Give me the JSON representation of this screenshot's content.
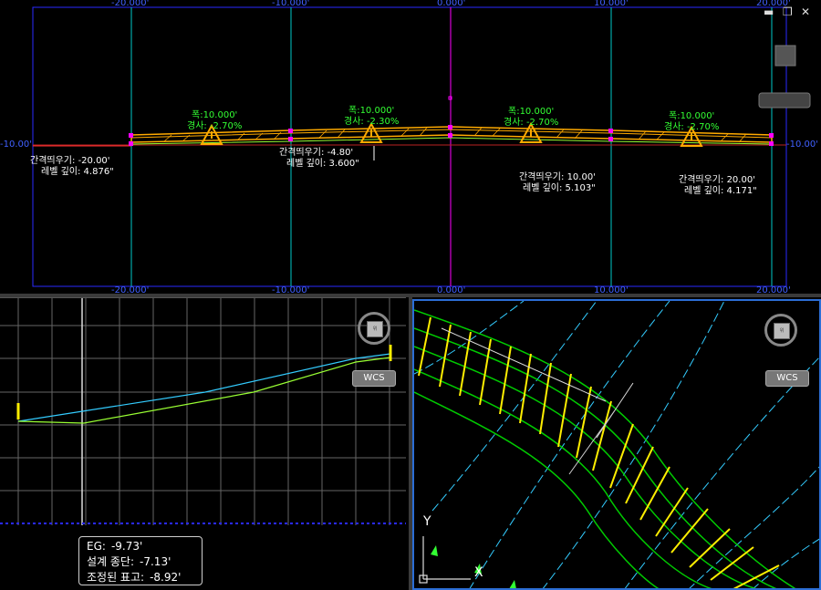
{
  "top": {
    "axis_top": [
      "-20.000'",
      "-10.000'",
      "0.000'",
      "10.000'",
      "20.000'"
    ],
    "axis_bottom": [
      "-20.000'",
      "-10.000'",
      "0.000'",
      "10.000'",
      "20.000'"
    ],
    "axis_left": "-10.00'",
    "axis_right": "-10.00'",
    "slopes": [
      {
        "width": "폭:10.000'",
        "slope": "경사: -2.70%"
      },
      {
        "width": "폭:10.000'",
        "slope": "경사: -2.30%"
      },
      {
        "width": "폭:10.000'",
        "slope": "경사: -2.70%"
      },
      {
        "width": "폭:10.000'",
        "slope": "경사: -2.70%"
      }
    ],
    "offsets": [
      {
        "offset_label": "간격띄우기:",
        "offset_value": "-20.00'",
        "depth_label": "레벨 깊이:",
        "depth_value": "4.876\""
      },
      {
        "offset_label": "간격띄우기:",
        "offset_value": "-4.80'",
        "depth_label": "레벨 깊이:",
        "depth_value": "3.600\""
      },
      {
        "offset_label": "간격띄우기:",
        "offset_value": "10.00'",
        "depth_label": "레벨 깊이:",
        "depth_value": "5.103\""
      },
      {
        "offset_label": "간격띄우기:",
        "offset_value": "20.00'",
        "depth_label": "레벨 깊이:",
        "depth_value": "4.171\""
      }
    ],
    "window_buttons": {
      "minimize": "▬",
      "restore": "❐",
      "close": "✕"
    }
  },
  "views": {
    "left_cube_face": "위",
    "left_wcs": "WCS",
    "right_cube_face": "위",
    "right_wcs": "WCS",
    "ucs_y": "Y",
    "ucs_x": "X"
  },
  "info": {
    "eg_label": "EG:",
    "eg_value": "-9.73'",
    "design_label": "설계 종단:",
    "design_value": "-7.13'",
    "adjusted_label": "조정된 표고:",
    "adjusted_value": "-8.92'"
  },
  "colors": {
    "grid": "#2a2aff",
    "offset_line": "#00c8c8",
    "centerline": "#ff00ff",
    "pavement": "#ffaa00",
    "slope_text": "#33ff33",
    "profile_design": "#33ccff",
    "profile_eg": "#99ff33"
  }
}
